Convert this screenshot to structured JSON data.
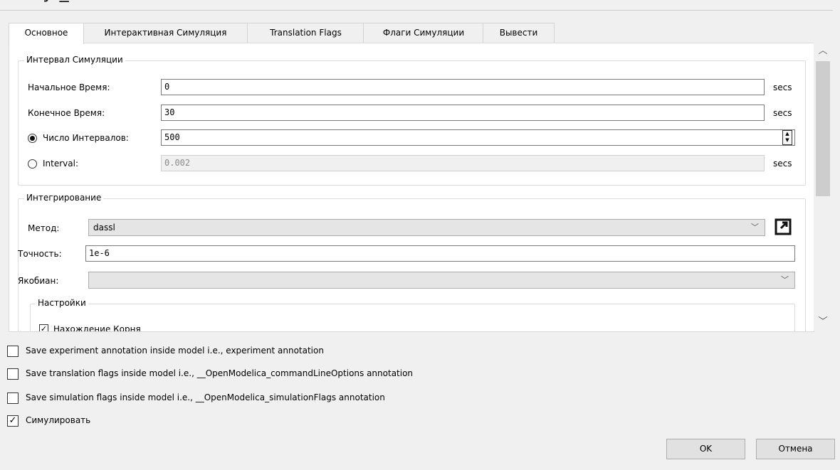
{
  "window": {
    "title_fragment": "у                _"
  },
  "tabs": [
    "Основное",
    "Интерактивная Симуляция",
    "Translation Flags",
    "Флаги Симуляции",
    "Вывести"
  ],
  "interval_group": {
    "title": "Интервал Симуляции",
    "start_label": "Начальное Время:",
    "start_value": "0",
    "stop_label": "Конечное Время:",
    "stop_value": "30",
    "intervals_label": "Число Интервалов:",
    "intervals_value": "500",
    "interval_label": "Interval:",
    "interval_value": "0.002",
    "unit": "secs",
    "selected_mode": "intervals"
  },
  "integration_group": {
    "title": "Интегрирование",
    "method_label": "Метод:",
    "method_value": "dassl",
    "tolerance_label": "Точность:",
    "tolerance_value": "1e-6",
    "jacobian_label": "Якобиан:",
    "jacobian_value": "",
    "settings_title": "Настройки",
    "settings_partial_item": "Нахождение Корня"
  },
  "checkboxes": [
    {
      "label": "Save experiment annotation inside model i.e., experiment annotation",
      "checked": false
    },
    {
      "label": "Save translation flags inside model i.e., __OpenModelica_commandLineOptions annotation",
      "checked": false
    },
    {
      "label": "Save simulation flags inside model i.e., __OpenModelica_simulationFlags annotation",
      "checked": false
    },
    {
      "label": "Симулировать",
      "checked": true
    }
  ],
  "buttons": {
    "ok": "OK",
    "cancel": "Отмена"
  },
  "icons": {
    "scroll_up": "chevron-up-icon",
    "scroll_down": "chevron-down-icon",
    "dropdown": "chevron-down-icon",
    "method_info": "open-external-icon",
    "check": "check-icon"
  }
}
